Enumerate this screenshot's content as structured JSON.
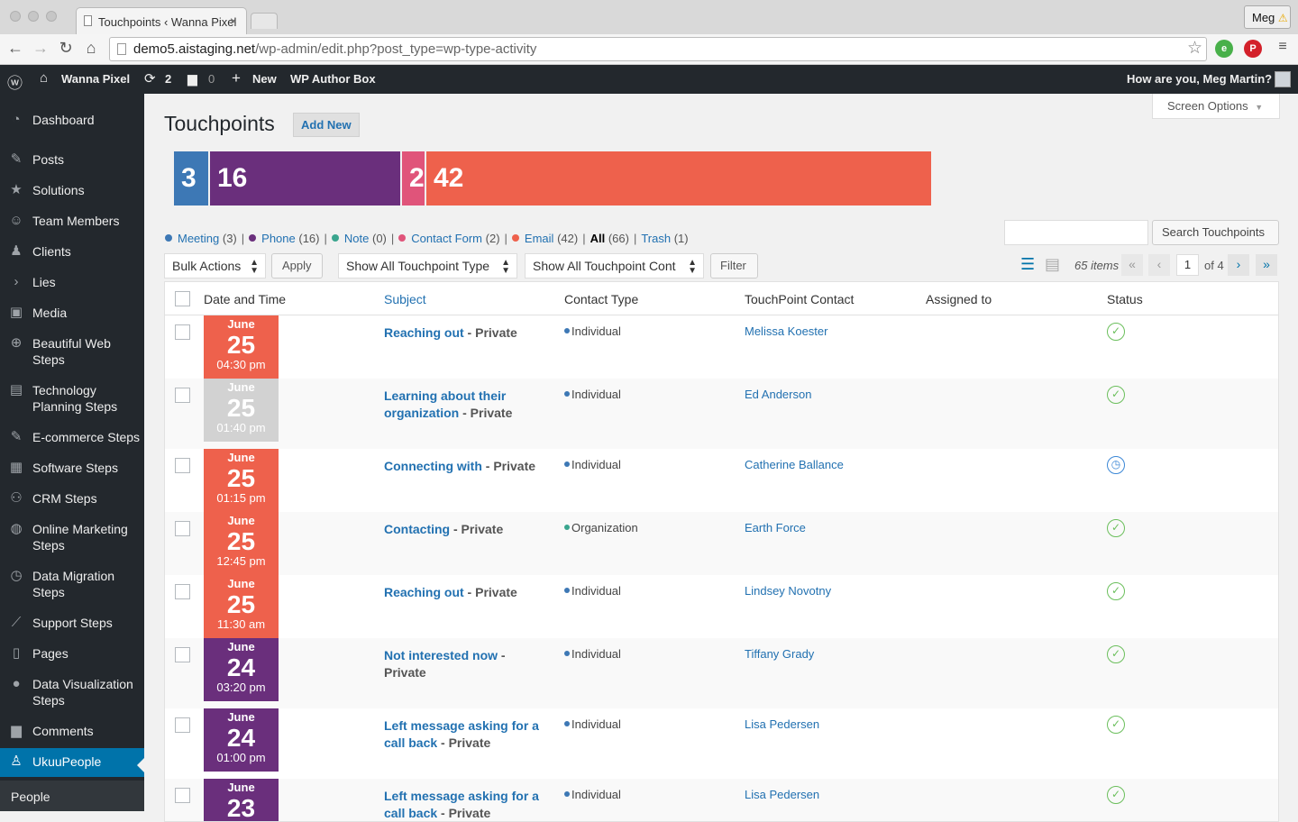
{
  "browser": {
    "tab_title": "Touchpoints ‹ Wanna Pixel",
    "user_button": "Meg",
    "url_host": "demo5.aistaging.net",
    "url_path": "/wp-admin/edit.php?post_type=wp-type-activity"
  },
  "adminbar": {
    "site_name": "Wanna Pixel",
    "updates_count": "2",
    "comments_count": "0",
    "new_label": "New",
    "plugin_label": "WP Author Box",
    "greeting": "How are you, Meg Martin?"
  },
  "sidebar": {
    "items": [
      {
        "label": "Dashboard",
        "icon": "dashboard-icon"
      },
      {
        "label": "Posts",
        "icon": "pin-icon"
      },
      {
        "label": "Solutions",
        "icon": "star-icon"
      },
      {
        "label": "Team Members",
        "icon": "smile-icon"
      },
      {
        "label": "Clients",
        "icon": "users-icon"
      },
      {
        "label": "Lies",
        "icon": "chevron-right-icon"
      },
      {
        "label": "Media",
        "icon": "media-icon"
      },
      {
        "label": "Beautiful Web Steps",
        "icon": "plus-circle-icon"
      },
      {
        "label": "Technology Planning Steps",
        "icon": "newspaper-icon"
      },
      {
        "label": "E-commerce Steps",
        "icon": "pin-icon"
      },
      {
        "label": "Software Steps",
        "icon": "grid-icon"
      },
      {
        "label": "CRM Steps",
        "icon": "groups-icon"
      },
      {
        "label": "Online Marketing Steps",
        "icon": "globe-icon"
      },
      {
        "label": "Data Migration Steps",
        "icon": "backup-icon"
      },
      {
        "label": "Support Steps",
        "icon": "chart-line-icon"
      },
      {
        "label": "Pages",
        "icon": "page-icon"
      },
      {
        "label": "Data Visualization Steps",
        "icon": "lightbulb-icon"
      },
      {
        "label": "Comments",
        "icon": "comment-icon"
      },
      {
        "label": "UkuuPeople",
        "icon": "person-icon"
      }
    ],
    "submenu_label": "People"
  },
  "page": {
    "title": "Touchpoints",
    "add_new": "Add New",
    "screen_options": "Screen Options"
  },
  "summary_bar": {
    "segments": [
      {
        "label": "3",
        "value": 3,
        "color": "#3d78b5"
      },
      {
        "label": "16",
        "value": 16,
        "color": "#6a2f7c"
      },
      {
        "label": "2",
        "value": 2,
        "color": "#e0547a"
      },
      {
        "label": "42",
        "value": 42,
        "color": "#ee614c"
      }
    ]
  },
  "filters": [
    {
      "label": "Meeting",
      "count": "(3)",
      "color": "#3d78b5"
    },
    {
      "label": "Phone",
      "count": "(16)",
      "color": "#6a2f7c"
    },
    {
      "label": "Note",
      "count": "(0)",
      "color": "#3aa58e"
    },
    {
      "label": "Contact Form",
      "count": "(2)",
      "color": "#e0547a"
    },
    {
      "label": "Email",
      "count": "(42)",
      "color": "#ee614c"
    }
  ],
  "filter_all": {
    "label": "All",
    "count": "(66)"
  },
  "filter_trash": {
    "label": "Trash",
    "count": "(1)"
  },
  "search_button": "Search Touchpoints",
  "controls": {
    "bulk_actions": "Bulk Actions",
    "apply": "Apply",
    "type_filter": "Show All Touchpoint Type",
    "contact_filter": "Show All Touchpoint Cont",
    "filter": "Filter",
    "items_count": "65 items",
    "current_page": "1",
    "of_pages": "of 4"
  },
  "table": {
    "headers": [
      "Date and Time",
      "Subject",
      "Contact Type",
      "TouchPoint Contact",
      "Assigned to",
      "Status"
    ],
    "rows": [
      {
        "month": "June",
        "day": "25",
        "time": "04:30 pm",
        "color": "#ee614c",
        "subject": "Reaching out",
        "suffix": " - Private",
        "ctype": "Individual",
        "cdot": "#3d78b5",
        "contact": "Melissa Koester",
        "status": "done"
      },
      {
        "month": "June",
        "day": "25",
        "time": "01:40 pm",
        "color": "#d2d2d2",
        "subject": "Learning about their organization",
        "suffix": " - Private",
        "ctype": "Individual",
        "cdot": "#3d78b5",
        "contact": "Ed Anderson",
        "status": "done"
      },
      {
        "month": "June",
        "day": "25",
        "time": "01:15 pm",
        "color": "#ee614c",
        "subject": "Connecting with",
        "suffix": " - Private",
        "ctype": "Individual",
        "cdot": "#3d78b5",
        "contact": "Catherine Ballance",
        "status": "pending"
      },
      {
        "month": "June",
        "day": "25",
        "time": "12:45 pm",
        "color": "#ee614c",
        "subject": "Contacting",
        "suffix": " - Private",
        "ctype": "Organization",
        "cdot": "#3aa58e",
        "contact": "Earth Force",
        "status": "done"
      },
      {
        "month": "June",
        "day": "25",
        "time": "11:30 am",
        "color": "#ee614c",
        "subject": "Reaching out",
        "suffix": " - Private",
        "ctype": "Individual",
        "cdot": "#3d78b5",
        "contact": "Lindsey Novotny",
        "status": "done"
      },
      {
        "month": "June",
        "day": "24",
        "time": "03:20 pm",
        "color": "#6a2f7c",
        "subject": "Not interested now",
        "suffix": " - Private",
        "ctype": "Individual",
        "cdot": "#3d78b5",
        "contact": "Tiffany Grady",
        "status": "done"
      },
      {
        "month": "June",
        "day": "24",
        "time": "01:00 pm",
        "color": "#6a2f7c",
        "subject": "Left message asking for a call back",
        "suffix": " - Private",
        "ctype": "Individual",
        "cdot": "#3d78b5",
        "contact": "Lisa Pedersen",
        "status": "done"
      },
      {
        "month": "June",
        "day": "23",
        "time": "",
        "color": "#6a2f7c",
        "subject": "Left message asking for a call back",
        "suffix": " - Private",
        "ctype": "Individual",
        "cdot": "#3d78b5",
        "contact": "Lisa Pedersen",
        "status": "done"
      }
    ]
  }
}
